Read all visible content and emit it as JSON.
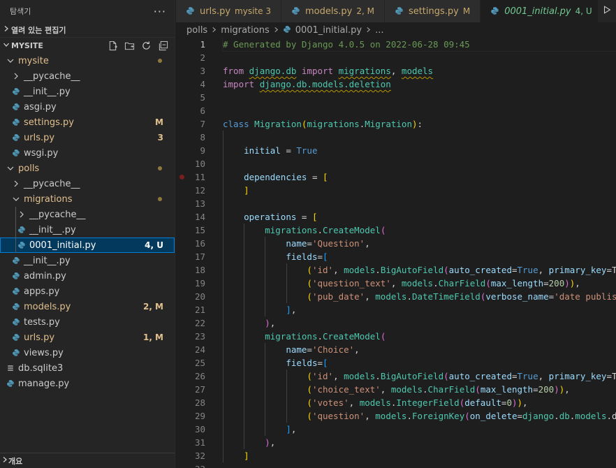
{
  "sidebar": {
    "title": "탐색기",
    "more": "···",
    "open_editors": "열려 있는 편집기",
    "workspace": "MYSITE",
    "outline": "개요",
    "tree": [
      {
        "label": "mysite",
        "type": "folder",
        "open": true,
        "depth": 1,
        "status": "folder-mod"
      },
      {
        "label": "__pycache__",
        "type": "folder",
        "open": false,
        "depth": 2
      },
      {
        "label": "__init__.py",
        "type": "py",
        "depth": 2
      },
      {
        "label": "asgi.py",
        "type": "py",
        "depth": 2
      },
      {
        "label": "settings.py",
        "type": "py",
        "depth": 2,
        "badge": "M",
        "status": "modified"
      },
      {
        "label": "urls.py",
        "type": "py",
        "depth": 2,
        "badge": "3",
        "status": "modified"
      },
      {
        "label": "wsgi.py",
        "type": "py",
        "depth": 2
      },
      {
        "label": "polls",
        "type": "folder",
        "open": true,
        "depth": 1,
        "status": "folder-mod"
      },
      {
        "label": "__pycache__",
        "type": "folder",
        "open": false,
        "depth": 2
      },
      {
        "label": "migrations",
        "type": "folder",
        "open": true,
        "depth": 2,
        "status": "folder-mod"
      },
      {
        "label": "__pycache__",
        "type": "folder",
        "open": false,
        "depth": 3
      },
      {
        "label": "__init__.py",
        "type": "py",
        "depth": 3
      },
      {
        "label": "0001_initial.py",
        "type": "py",
        "depth": 3,
        "badge": "4, U",
        "status": "untracked",
        "selected": true
      },
      {
        "label": "__init__.py",
        "type": "py",
        "depth": 2
      },
      {
        "label": "admin.py",
        "type": "py",
        "depth": 2
      },
      {
        "label": "apps.py",
        "type": "py",
        "depth": 2
      },
      {
        "label": "models.py",
        "type": "py",
        "depth": 2,
        "badge": "2, M",
        "status": "modified"
      },
      {
        "label": "tests.py",
        "type": "py",
        "depth": 2
      },
      {
        "label": "urls.py",
        "type": "py",
        "depth": 2,
        "badge": "1, M",
        "status": "modified"
      },
      {
        "label": "views.py",
        "type": "py",
        "depth": 2
      },
      {
        "label": "db.sqlite3",
        "type": "db",
        "depth": 1
      },
      {
        "label": "manage.py",
        "type": "py",
        "depth": 1
      }
    ]
  },
  "tabs": [
    {
      "label": "urls.py",
      "desc": "mysite 3",
      "status": "modified",
      "active": false
    },
    {
      "label": "models.py",
      "desc": "2, M",
      "status": "modified",
      "active": false
    },
    {
      "label": "settings.py",
      "desc": "M",
      "status": "modified",
      "active": false
    },
    {
      "label": "0001_initial.py",
      "desc": "4, U",
      "status": "untracked",
      "active": true
    }
  ],
  "breadcrumb": [
    "polls",
    "migrations",
    "0001_initial.py",
    "..."
  ],
  "editor": {
    "current_line": 1,
    "breakpoint_line": 11,
    "lines": [
      {
        "n": 1,
        "indent": 0,
        "tokens": [
          [
            "cmt",
            "# Generated by Django 4.0.5 on 2022-06-28 09:45"
          ]
        ]
      },
      {
        "n": 2,
        "indent": 0,
        "tokens": []
      },
      {
        "n": 3,
        "indent": 0,
        "tokens": [
          [
            "kw",
            "from"
          ],
          [
            "punc",
            " "
          ],
          [
            "mod~",
            "django.db"
          ],
          [
            "punc",
            " "
          ],
          [
            "kw",
            "import"
          ],
          [
            "punc",
            " "
          ],
          [
            "mod~",
            "migrations"
          ],
          [
            "punc",
            ", "
          ],
          [
            "mod~",
            "models"
          ]
        ]
      },
      {
        "n": 4,
        "indent": 0,
        "tokens": [
          [
            "kw",
            "import"
          ],
          [
            "punc",
            " "
          ],
          [
            "mod~",
            "django.db.models.deletion"
          ]
        ]
      },
      {
        "n": 5,
        "indent": 0,
        "tokens": []
      },
      {
        "n": 6,
        "indent": 0,
        "tokens": []
      },
      {
        "n": 7,
        "indent": 0,
        "tokens": [
          [
            "def",
            "class"
          ],
          [
            "punc",
            " "
          ],
          [
            "cls",
            "Migration"
          ],
          [
            "b1",
            "("
          ],
          [
            "mod",
            "migrations"
          ],
          [
            "punc",
            "."
          ],
          [
            "cls",
            "Migration"
          ],
          [
            "b1",
            ")"
          ],
          [
            "punc",
            ":"
          ]
        ]
      },
      {
        "n": 8,
        "indent": 1,
        "tokens": []
      },
      {
        "n": 9,
        "indent": 1,
        "tokens": [
          [
            "punc",
            "    "
          ],
          [
            "var",
            "initial"
          ],
          [
            "punc",
            " = "
          ],
          [
            "def",
            "True"
          ]
        ]
      },
      {
        "n": 10,
        "indent": 1,
        "tokens": []
      },
      {
        "n": 11,
        "indent": 1,
        "tokens": [
          [
            "punc",
            "    "
          ],
          [
            "var",
            "dependencies"
          ],
          [
            "punc",
            " = "
          ],
          [
            "b1",
            "["
          ]
        ]
      },
      {
        "n": 12,
        "indent": 1,
        "tokens": [
          [
            "punc",
            "    "
          ],
          [
            "b1",
            "]"
          ]
        ]
      },
      {
        "n": 13,
        "indent": 1,
        "tokens": []
      },
      {
        "n": 14,
        "indent": 1,
        "tokens": [
          [
            "punc",
            "    "
          ],
          [
            "var",
            "operations"
          ],
          [
            "punc",
            " = "
          ],
          [
            "b1",
            "["
          ]
        ]
      },
      {
        "n": 15,
        "indent": 2,
        "tokens": [
          [
            "punc",
            "        "
          ],
          [
            "mod",
            "migrations"
          ],
          [
            "punc",
            "."
          ],
          [
            "cls",
            "CreateModel"
          ],
          [
            "b2",
            "("
          ]
        ]
      },
      {
        "n": 16,
        "indent": 3,
        "tokens": [
          [
            "punc",
            "            "
          ],
          [
            "var",
            "name"
          ],
          [
            "punc",
            "="
          ],
          [
            "str",
            "'Question'"
          ],
          [
            "punc",
            ","
          ]
        ]
      },
      {
        "n": 17,
        "indent": 3,
        "tokens": [
          [
            "punc",
            "            "
          ],
          [
            "var",
            "fields"
          ],
          [
            "punc",
            "="
          ],
          [
            "b3",
            "["
          ]
        ]
      },
      {
        "n": 18,
        "indent": 4,
        "tokens": [
          [
            "punc",
            "                "
          ],
          [
            "b1",
            "("
          ],
          [
            "str",
            "'id'"
          ],
          [
            "punc",
            ", "
          ],
          [
            "mod",
            "models"
          ],
          [
            "punc",
            "."
          ],
          [
            "cls",
            "BigAutoField"
          ],
          [
            "b2",
            "("
          ],
          [
            "var",
            "auto_created"
          ],
          [
            "punc",
            "="
          ],
          [
            "def",
            "True"
          ],
          [
            "punc",
            ", "
          ],
          [
            "var",
            "primary_key"
          ],
          [
            "punc",
            "=True, serialize=False, verbose_name='ID'"
          ]
        ]
      },
      {
        "n": 19,
        "indent": 4,
        "tokens": [
          [
            "punc",
            "                "
          ],
          [
            "b1",
            "("
          ],
          [
            "str",
            "'question_text'"
          ],
          [
            "punc",
            ", "
          ],
          [
            "mod",
            "models"
          ],
          [
            "punc",
            "."
          ],
          [
            "cls",
            "CharField"
          ],
          [
            "b2",
            "("
          ],
          [
            "var",
            "max_length"
          ],
          [
            "punc",
            "="
          ],
          [
            "num",
            "200"
          ],
          [
            "b2",
            ")"
          ],
          [
            "b1",
            ")"
          ],
          [
            "punc",
            ","
          ]
        ]
      },
      {
        "n": 20,
        "indent": 4,
        "tokens": [
          [
            "punc",
            "                "
          ],
          [
            "b1",
            "("
          ],
          [
            "str",
            "'pub_date'"
          ],
          [
            "punc",
            ", "
          ],
          [
            "mod",
            "models"
          ],
          [
            "punc",
            "."
          ],
          [
            "cls",
            "DateTimeField"
          ],
          [
            "b2",
            "("
          ],
          [
            "var",
            "verbose_name"
          ],
          [
            "punc",
            "="
          ],
          [
            "str",
            "'date published'"
          ],
          [
            "b2",
            ")"
          ],
          [
            "b1",
            ")"
          ],
          [
            "punc",
            ","
          ]
        ]
      },
      {
        "n": 21,
        "indent": 3,
        "tokens": [
          [
            "punc",
            "            "
          ],
          [
            "b3",
            "]"
          ],
          [
            "punc",
            ","
          ]
        ]
      },
      {
        "n": 22,
        "indent": 2,
        "tokens": [
          [
            "punc",
            "        "
          ],
          [
            "b2",
            ")"
          ],
          [
            "punc",
            ","
          ]
        ]
      },
      {
        "n": 23,
        "indent": 2,
        "tokens": [
          [
            "punc",
            "        "
          ],
          [
            "mod",
            "migrations"
          ],
          [
            "punc",
            "."
          ],
          [
            "cls",
            "CreateModel"
          ],
          [
            "b2",
            "("
          ]
        ]
      },
      {
        "n": 24,
        "indent": 3,
        "tokens": [
          [
            "punc",
            "            "
          ],
          [
            "var",
            "name"
          ],
          [
            "punc",
            "="
          ],
          [
            "str",
            "'Choice'"
          ],
          [
            "punc",
            ","
          ]
        ]
      },
      {
        "n": 25,
        "indent": 3,
        "tokens": [
          [
            "punc",
            "            "
          ],
          [
            "var",
            "fields"
          ],
          [
            "punc",
            "="
          ],
          [
            "b3",
            "["
          ]
        ]
      },
      {
        "n": 26,
        "indent": 4,
        "tokens": [
          [
            "punc",
            "                "
          ],
          [
            "b1",
            "("
          ],
          [
            "str",
            "'id'"
          ],
          [
            "punc",
            ", "
          ],
          [
            "mod",
            "models"
          ],
          [
            "punc",
            "."
          ],
          [
            "cls",
            "BigAutoField"
          ],
          [
            "b2",
            "("
          ],
          [
            "var",
            "auto_created"
          ],
          [
            "punc",
            "="
          ],
          [
            "def",
            "True"
          ],
          [
            "punc",
            ", "
          ],
          [
            "var",
            "primary_key"
          ],
          [
            "punc",
            "=True, serialize=False, verbose_name='ID'"
          ]
        ]
      },
      {
        "n": 27,
        "indent": 4,
        "tokens": [
          [
            "punc",
            "                "
          ],
          [
            "b1",
            "("
          ],
          [
            "str",
            "'choice_text'"
          ],
          [
            "punc",
            ", "
          ],
          [
            "mod",
            "models"
          ],
          [
            "punc",
            "."
          ],
          [
            "cls",
            "CharField"
          ],
          [
            "b2",
            "("
          ],
          [
            "var",
            "max_length"
          ],
          [
            "punc",
            "="
          ],
          [
            "num",
            "200"
          ],
          [
            "b2",
            ")"
          ],
          [
            "b1",
            ")"
          ],
          [
            "punc",
            ","
          ]
        ]
      },
      {
        "n": 28,
        "indent": 4,
        "tokens": [
          [
            "punc",
            "                "
          ],
          [
            "b1",
            "("
          ],
          [
            "str",
            "'votes'"
          ],
          [
            "punc",
            ", "
          ],
          [
            "mod",
            "models"
          ],
          [
            "punc",
            "."
          ],
          [
            "cls",
            "IntegerField"
          ],
          [
            "b2",
            "("
          ],
          [
            "var",
            "default"
          ],
          [
            "punc",
            "="
          ],
          [
            "num",
            "0"
          ],
          [
            "b2",
            ")"
          ],
          [
            "b1",
            ")"
          ],
          [
            "punc",
            ","
          ]
        ]
      },
      {
        "n": 29,
        "indent": 4,
        "tokens": [
          [
            "punc",
            "                "
          ],
          [
            "b1",
            "("
          ],
          [
            "str",
            "'question'"
          ],
          [
            "punc",
            ", "
          ],
          [
            "mod",
            "models"
          ],
          [
            "punc",
            "."
          ],
          [
            "cls",
            "ForeignKey"
          ],
          [
            "b2",
            "("
          ],
          [
            "var",
            "on_delete"
          ],
          [
            "punc",
            "="
          ],
          [
            "mod",
            "django"
          ],
          [
            "punc",
            "."
          ],
          [
            "mod",
            "db"
          ],
          [
            "punc",
            "."
          ],
          [
            "mod",
            "models"
          ],
          [
            "punc",
            ".deletion.CASCADE, to='polls.question'))"
          ]
        ]
      },
      {
        "n": 30,
        "indent": 3,
        "tokens": [
          [
            "punc",
            "            "
          ],
          [
            "b3",
            "]"
          ],
          [
            "punc",
            ","
          ]
        ]
      },
      {
        "n": 31,
        "indent": 2,
        "tokens": [
          [
            "punc",
            "        "
          ],
          [
            "b2",
            ")"
          ],
          [
            "punc",
            ","
          ]
        ]
      },
      {
        "n": 32,
        "indent": 1,
        "tokens": [
          [
            "punc",
            "    "
          ],
          [
            "b1",
            "]"
          ]
        ]
      },
      {
        "n": 33,
        "indent": 0,
        "tokens": []
      }
    ]
  },
  "colors": {
    "accent": "#007fd4",
    "modified": "#e2c08d",
    "untracked": "#73c991",
    "python_icon": "#519aba"
  }
}
